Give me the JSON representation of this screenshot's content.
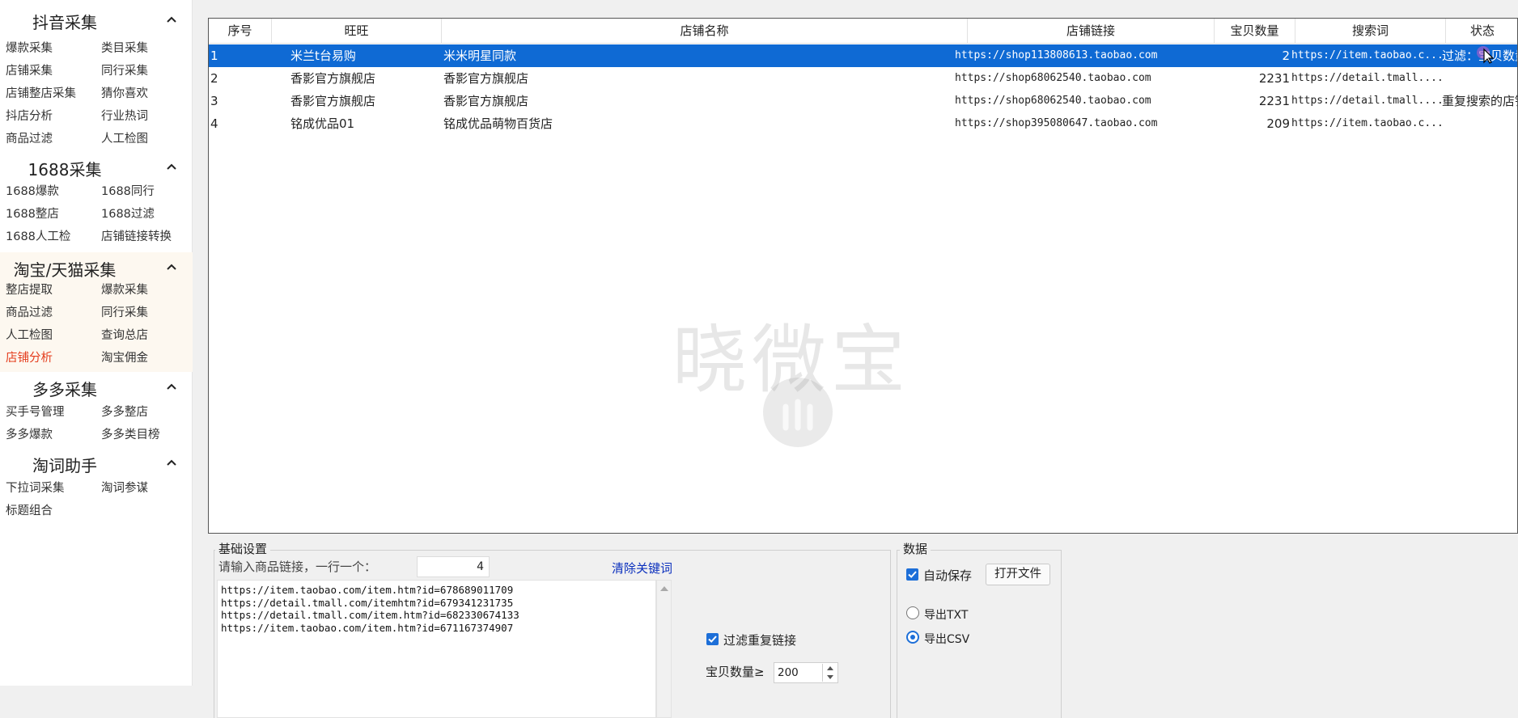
{
  "sidebar": {
    "sections": [
      {
        "title": "抖音采集",
        "items": [
          "爆款采集",
          "类目采集",
          "店铺采集",
          "同行采集",
          "店铺整店采集",
          "猜你喜欢",
          "抖店分析",
          "行业热词",
          "商品过滤",
          "人工检图"
        ]
      },
      {
        "title": "1688采集",
        "items": [
          "1688爆款",
          "1688同行",
          "1688整店",
          "1688过滤",
          "1688人工检",
          "店铺链接转换"
        ]
      },
      {
        "title": "淘宝/天猫采集",
        "items": [
          "整店提取",
          "爆款采集",
          "商品过滤",
          "同行采集",
          "人工检图",
          "查询总店",
          "店铺分析",
          "淘宝佣金"
        ]
      },
      {
        "title": "多多采集",
        "items": [
          "买手号管理",
          "多多整店",
          "多多爆款",
          "多多类目榜"
        ]
      },
      {
        "title": "淘词助手",
        "items": [
          "下拉词采集",
          "淘词参谋",
          "标题组合"
        ]
      }
    ],
    "current_item": "店铺分析"
  },
  "table": {
    "columns": [
      "序号",
      "旺旺",
      "店铺名称",
      "店铺链接",
      "宝贝数量",
      "搜索词",
      "状态"
    ],
    "rows": [
      {
        "index": "1",
        "wangwang": "米兰t台易购",
        "shop_name": "米米明星同款",
        "shop_link": "https://shop113808613.taobao.com",
        "count": "2",
        "search": "https://item.taobao.c...",
        "status": "过滤：宝贝数量"
      },
      {
        "index": "2",
        "wangwang": "香影官方旗舰店",
        "shop_name": "香影官方旗舰店",
        "shop_link": "https://shop68062540.taobao.com",
        "count": "2231",
        "search": "https://detail.tmall....",
        "status": ""
      },
      {
        "index": "3",
        "wangwang": "香影官方旗舰店",
        "shop_name": "香影官方旗舰店",
        "shop_link": "https://shop68062540.taobao.com",
        "count": "2231",
        "search": "https://detail.tmall....",
        "status": "重复搜索的店铺"
      },
      {
        "index": "4",
        "wangwang": "铭成优品01",
        "shop_name": "铭成优品萌物百货店",
        "shop_link": "https://shop395080647.taobao.com",
        "count": "209",
        "search": "https://item.taobao.c...",
        "status": ""
      }
    ],
    "selected_row": 0,
    "watermark": "晓微宝"
  },
  "basic_settings": {
    "title": "基础设置",
    "prompt": "请输入商品链接，一行一个：",
    "count": "4",
    "clear_label": "清除关键词",
    "links": [
      "https://item.taobao.com/item.htm?id=678689011709",
      "https://detail.tmall.com/itemhtm?id=679341231735",
      "https://detail.tmall.com/item.htm?id=682330674133",
      "https://item.taobao.com/item.htm?id=671167374907"
    ],
    "filter_dup_label": "过滤重复链接",
    "filter_dup_checked": true,
    "qty_label": "宝贝数量≥",
    "qty_value": "200"
  },
  "data_panel": {
    "title": "数据",
    "autosave_label": "自动保存",
    "autosave_checked": true,
    "open_file_label": "打开文件",
    "export_txt_label": "导出TXT",
    "export_csv_label": "导出CSV",
    "export_selected": "csv"
  },
  "colors": {
    "selection": "#0f6ad4",
    "current_menu": "#e43c1c",
    "accent": "#1d6fd8",
    "link": "#0a2fbd"
  }
}
